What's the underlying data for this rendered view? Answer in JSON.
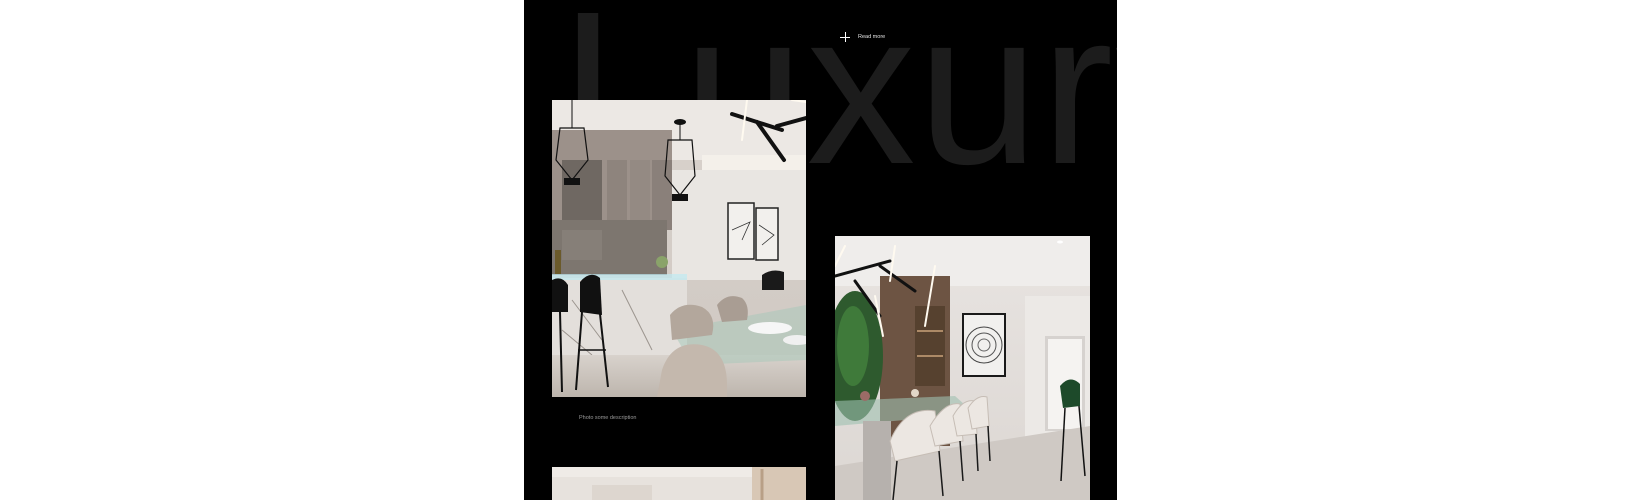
{
  "hero": {
    "headline": "Luxury"
  },
  "actions": {
    "read_more_label": "Read more",
    "read_more_icon": "plus-icon"
  },
  "gallery": {
    "items": [
      {
        "caption": "Photo some description",
        "subject": "kitchen-dining-interior"
      },
      {
        "caption": "",
        "subject": "dining-room-interior"
      },
      {
        "caption": "",
        "subject": "interior-partial"
      }
    ]
  },
  "colors": {
    "page_background": "#ffffff",
    "panel_background": "#000000",
    "headline_color": "#1c1c1c",
    "caption_color": "#9a9a9a"
  }
}
